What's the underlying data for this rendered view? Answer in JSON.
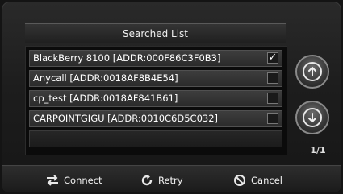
{
  "title": "Searched List",
  "devices": [
    {
      "label": "BlackBerry 8100 [ADDR:000F86C3F0B3]",
      "checked": true
    },
    {
      "label": "Anycall [ADDR:0018AF8B4E54]",
      "checked": false
    },
    {
      "label": "cp_test [ADDR:0018AF841B61]",
      "checked": false
    },
    {
      "label": "CARPOINTGIGU [ADDR:0010C6D5C032]",
      "checked": false
    },
    {
      "label": "",
      "checked": false
    }
  ],
  "checkmark": "✓",
  "page_indicator": "1/1",
  "footer": {
    "connect_label": "Connect",
    "retry_label": "Retry",
    "cancel_label": "Cancel"
  },
  "icons": {
    "scroll_up": "arrow-up-icon",
    "scroll_down": "arrow-down-icon",
    "connect": "swap-arrows-icon",
    "retry": "refresh-icon",
    "cancel": "no-entry-icon"
  }
}
